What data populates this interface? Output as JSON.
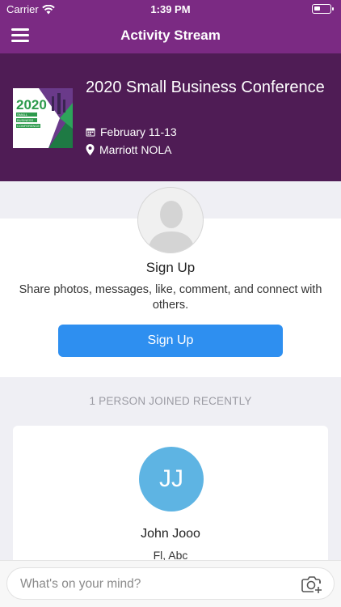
{
  "status_bar": {
    "carrier": "Carrier",
    "time": "1:39 PM"
  },
  "nav": {
    "title": "Activity Stream",
    "menu_icon": "hamburger-menu-icon"
  },
  "event": {
    "title": "2020 Small Business Conference",
    "logo": {
      "year": "2020",
      "line1": "SMALL",
      "line2": "BUSINESS",
      "line3": "CONFERENCE"
    },
    "date": "February 11-13",
    "location": "Marriott NOLA",
    "date_icon": "calendar-icon",
    "location_icon": "map-pin-icon"
  },
  "signup": {
    "title": "Sign Up",
    "description": "Share photos, messages, like, comment, and connect with others.",
    "button_label": "Sign Up",
    "avatar_icon": "person-placeholder-icon"
  },
  "joined": {
    "header": "1 PERSON JOINED RECENTLY",
    "people": [
      {
        "initials": "JJ",
        "name": "John Jooo",
        "subtitle": "Fl, Abc"
      }
    ]
  },
  "compose": {
    "placeholder": "What's on your mind?",
    "camera_icon": "camera-add-icon"
  },
  "colors": {
    "nav_purple": "#7b2a83",
    "header_purple": "#4f1c55",
    "button_blue": "#2e8ff0",
    "avatar_blue": "#5eb4e3"
  }
}
